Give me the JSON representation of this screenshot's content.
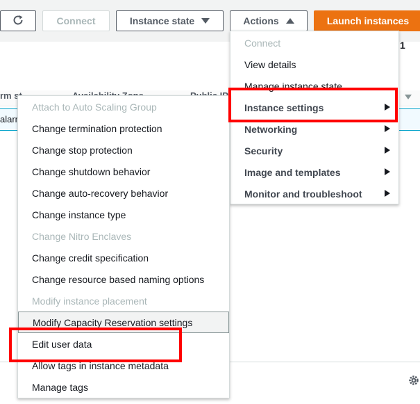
{
  "toolbar": {
    "connect_label": "Connect",
    "instance_state_label": "Instance state",
    "actions_label": "Actions",
    "launch_label": "Launch instances",
    "page_number": "1"
  },
  "table": {
    "col_alarm_status": "rm st",
    "col_availability_zone": "Availability Zone",
    "col_public": "Public IP",
    "row_alarm_fragment": "alarm"
  },
  "actions_menu": {
    "items": [
      {
        "label": "Connect",
        "disabled": true
      },
      {
        "label": "View details"
      },
      {
        "label": "Manage instance state"
      },
      {
        "label": "Instance settings",
        "submenu": true
      },
      {
        "label": "Networking",
        "submenu": true
      },
      {
        "label": "Security",
        "submenu": true
      },
      {
        "label": "Image and templates",
        "submenu": true
      },
      {
        "label": "Monitor and troubleshoot",
        "submenu": true
      }
    ]
  },
  "instance_settings_menu": {
    "items": [
      {
        "label": "Attach to Auto Scaling Group",
        "disabled": true
      },
      {
        "label": "Change termination protection"
      },
      {
        "label": "Change stop protection"
      },
      {
        "label": "Change shutdown behavior"
      },
      {
        "label": "Change auto-recovery behavior"
      },
      {
        "label": "Change instance type"
      },
      {
        "label": "Change Nitro Enclaves",
        "disabled": true
      },
      {
        "label": "Change credit specification"
      },
      {
        "label": "Change resource based naming options"
      },
      {
        "label": "Modify instance placement",
        "disabled": true
      },
      {
        "label": "Modify Capacity Reservation settings"
      },
      {
        "label": "Edit user data"
      },
      {
        "label": "Allow tags in instance metadata"
      },
      {
        "label": "Manage tags"
      }
    ]
  },
  "colors": {
    "primary": "#ec7211",
    "highlight_box": "#ff0000",
    "disabled_text": "#aab7b8"
  }
}
